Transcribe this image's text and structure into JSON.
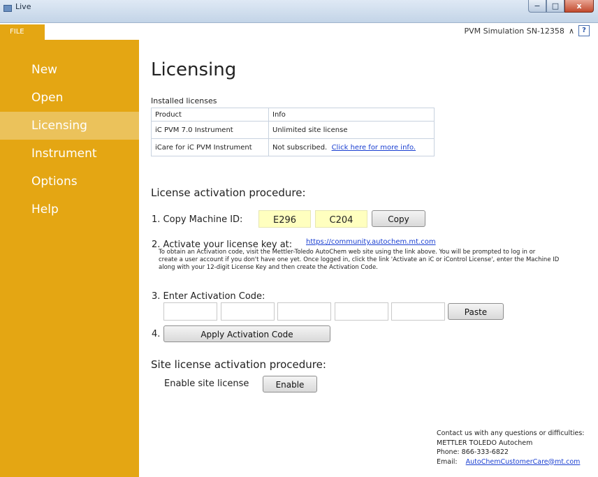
{
  "window": {
    "title": "Live",
    "minimize": "−",
    "maximize": "□",
    "close": "x"
  },
  "file_tab": "FILE",
  "header": {
    "device": "PVM Simulation SN-12358",
    "collapse": "∧",
    "help": "?"
  },
  "sidebar": {
    "items": [
      {
        "label": "New"
      },
      {
        "label": "Open"
      },
      {
        "label": "Licensing"
      },
      {
        "label": "Instrument"
      },
      {
        "label": "Options"
      },
      {
        "label": "Help"
      }
    ],
    "active": "Licensing"
  },
  "main": {
    "title": "Licensing",
    "installed_label": "Installed licenses",
    "table": {
      "headers": [
        "Product",
        "Info"
      ],
      "rows": [
        {
          "product": "iC PVM 7.0 Instrument",
          "info": "Unlimited site license",
          "link": ""
        },
        {
          "product": "iCare for iC PVM Instrument",
          "info": "Not subscribed.",
          "link": "Click here for more info."
        }
      ]
    },
    "procedure_title": "License activation procedure:",
    "step1": {
      "label": "1. Copy Machine ID:",
      "id_part1": "E296",
      "id_part2": "C204",
      "button": "Copy"
    },
    "step2": {
      "label": "2. Activate your license key at:",
      "link": "https://community.autochem.mt.com",
      "info_lines": [
        "To obtain an Activation code, visit the Mettler-Toledo AutoChem web site using the link above. You will be prompted to log in or",
        "create a user account if you don't have one yet. Once logged in, click the link 'Activate an iC or iControl License', enter the Machine ID",
        "along with your 12-digit License Key and then create the Activation Code."
      ]
    },
    "step3": {
      "label": "3. Enter Activation Code:",
      "button": "Paste"
    },
    "step4": {
      "label": "4.",
      "button": "Apply Activation Code"
    },
    "site_title": "Site license activation procedure:",
    "site": {
      "label": "Enable site license",
      "button": "Enable"
    }
  },
  "contact": {
    "line1": "Contact us with any questions or difficulties:",
    "line2": "METTLER TOLEDO Autochem",
    "line3": "Phone: 866-333-6822",
    "email_label": "Email:",
    "email": "AutoChemCustomerCare@mt.com"
  }
}
